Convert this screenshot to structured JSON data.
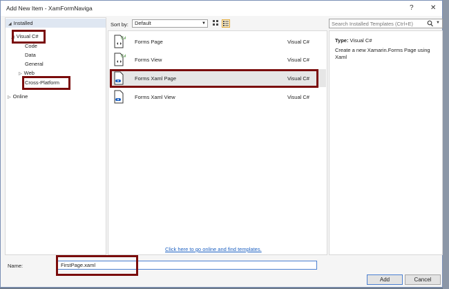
{
  "window": {
    "title": "Add New Item - XamFormNaviga",
    "help_label": "?",
    "close_label": "✕"
  },
  "tree": {
    "installed": "Installed",
    "visual_csharp": "Visual C#",
    "children": [
      "Code",
      "Data",
      "General",
      "Web",
      "Cross-Platform"
    ],
    "online": "Online"
  },
  "toolbar": {
    "sort_label": "Sort by:",
    "sort_value": "Default"
  },
  "search": {
    "placeholder": "Search Installed Templates (Ctrl+E)"
  },
  "templates": [
    {
      "name": "Forms Page",
      "lang": "Visual C#"
    },
    {
      "name": "Forms View",
      "lang": "Visual C#"
    },
    {
      "name": "Forms Xaml Page",
      "lang": "Visual C#"
    },
    {
      "name": "Forms Xaml View",
      "lang": "Visual C#"
    }
  ],
  "online_link": "Click here to go online and find templates.",
  "details": {
    "type_key": "Type:",
    "type_value": "Visual C#",
    "description": "Create a new Xamarin.Forms Page using Xaml"
  },
  "bottom": {
    "name_label": "Name:",
    "name_value": "FirstPage.xaml",
    "add_label": "Add",
    "cancel_label": "Cancel"
  },
  "colors": {
    "highlight": "#7a0b0b",
    "link": "#1b5fc1",
    "selection": "#e6e6e6"
  }
}
